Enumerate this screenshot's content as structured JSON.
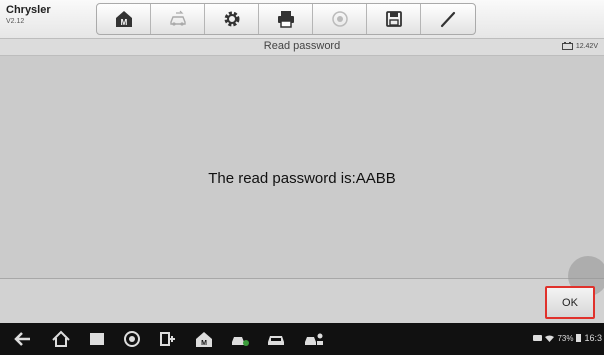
{
  "app": {
    "title": "Chrysler",
    "version": "V2.12"
  },
  "toolbar": {
    "buttons": [
      {
        "name": "home-button",
        "icon": "home-m-icon"
      },
      {
        "name": "vehicle-swap-button",
        "icon": "car-swap-icon"
      },
      {
        "name": "settings-button",
        "icon": "gear-icon"
      },
      {
        "name": "print-button",
        "icon": "printer-icon"
      },
      {
        "name": "help-button",
        "icon": "help-icon"
      },
      {
        "name": "save-button",
        "icon": "floppy-icon"
      },
      {
        "name": "edit-button",
        "icon": "pen-icon"
      }
    ]
  },
  "header": {
    "subtitle": "Read password",
    "voltage": "12.42V"
  },
  "main": {
    "message": "The read password is:AABB"
  },
  "footer": {
    "ok_label": "OK"
  },
  "status": {
    "battery": "73%",
    "time": "16:3"
  },
  "colors": {
    "highlight": "#e0312b"
  }
}
